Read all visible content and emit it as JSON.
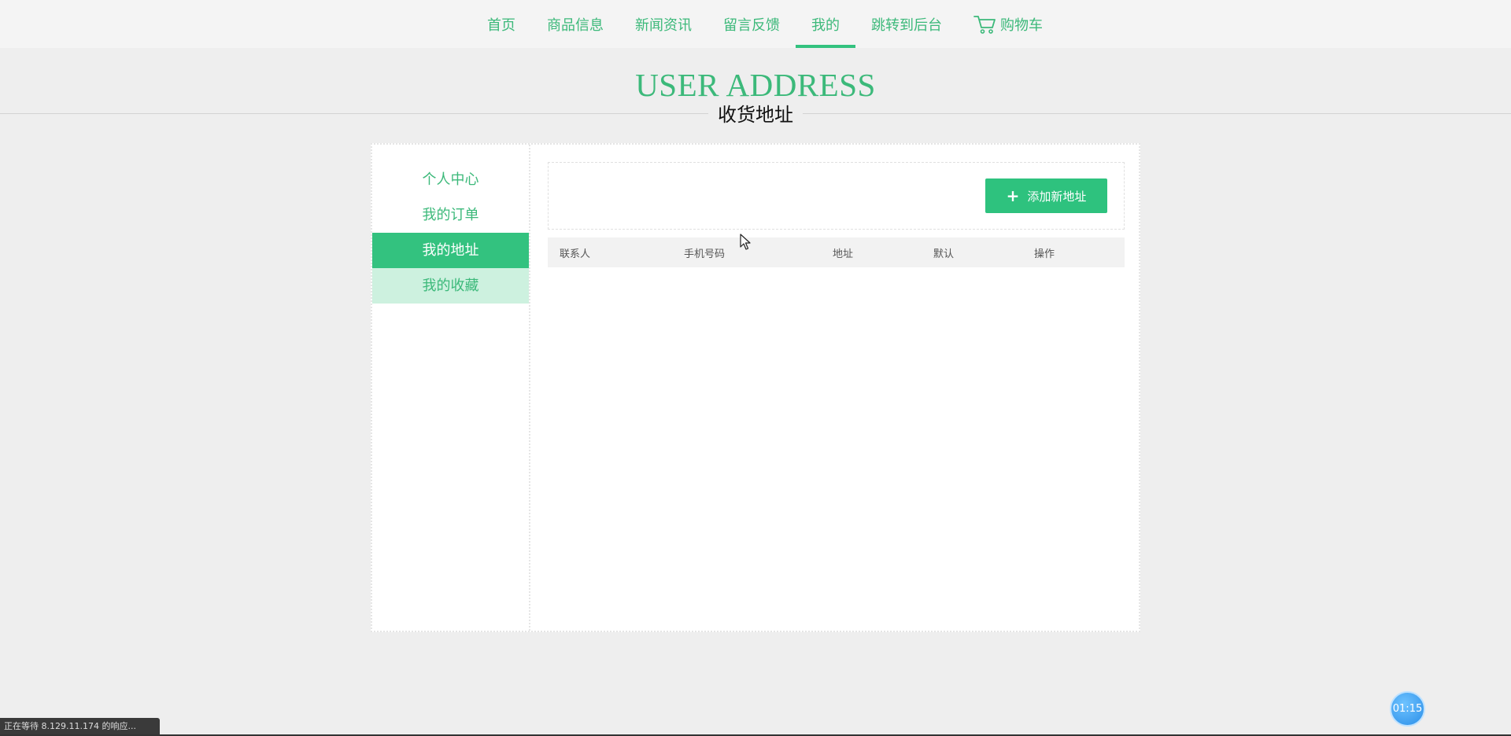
{
  "nav": {
    "items": [
      {
        "label": "首页"
      },
      {
        "label": "商品信息"
      },
      {
        "label": "新闻资讯"
      },
      {
        "label": "留言反馈"
      },
      {
        "label": "我的"
      },
      {
        "label": "跳转到后台"
      },
      {
        "label": "购物车",
        "icon": "cart-icon"
      }
    ],
    "active": "我的"
  },
  "header": {
    "title": "USER ADDRESS",
    "subtitle": "收货地址"
  },
  "sidebar": {
    "items": [
      {
        "label": "个人中心"
      },
      {
        "label": "我的订单"
      },
      {
        "label": "我的地址"
      },
      {
        "label": "我的收藏"
      }
    ],
    "active": "我的地址",
    "hovered": "我的收藏"
  },
  "main": {
    "add_button": {
      "icon": "plus-icon",
      "label": "添加新地址"
    },
    "table": {
      "columns": [
        "联系人",
        "手机号码",
        "地址",
        "默认",
        "操作"
      ],
      "rows": []
    }
  },
  "status_bar": {
    "text": "正在等待 8.129.11.174 的响应..."
  },
  "timer": {
    "text": "01:15"
  },
  "colors": {
    "accent": "#33c27f",
    "accent_text": "#3cb97a",
    "hover_bg": "#cdf1df",
    "background": "#eeeeee"
  }
}
